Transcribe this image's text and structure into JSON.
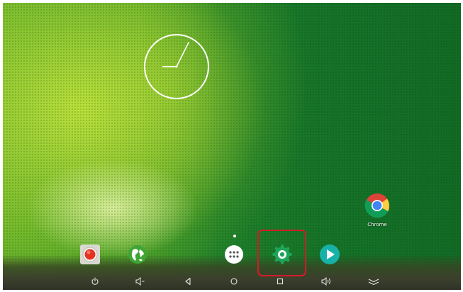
{
  "screen": {
    "wallpaper": "green-bokeh-wallpaper",
    "colors": {
      "accent_highlight": "#d7192a",
      "wallpaper_dark": "#167329",
      "wallpaper_light": "#9fd13a"
    }
  },
  "clock_widget": {
    "type": "analog-clock",
    "icon": "analog-clock-icon"
  },
  "desktop_shortcuts": [
    {
      "label": "Chrome",
      "icon": "chrome-icon"
    }
  ],
  "page_indicator": {
    "current": 1,
    "total": 1
  },
  "dock": [
    {
      "icon": "recorder-icon",
      "label": ""
    },
    {
      "icon": "browser-globe-icon",
      "label": ""
    },
    {
      "icon": "app-drawer-icon",
      "label": ""
    },
    {
      "icon": "settings-gear-icon",
      "label": "",
      "highlighted": true
    },
    {
      "icon": "play-store-icon",
      "label": ""
    }
  ],
  "navigation_bar": [
    {
      "icon": "power-icon"
    },
    {
      "icon": "volume-down-icon"
    },
    {
      "icon": "back-icon"
    },
    {
      "icon": "home-icon"
    },
    {
      "icon": "recents-icon"
    },
    {
      "icon": "volume-up-icon"
    },
    {
      "icon": "hide-bar-icon"
    }
  ]
}
